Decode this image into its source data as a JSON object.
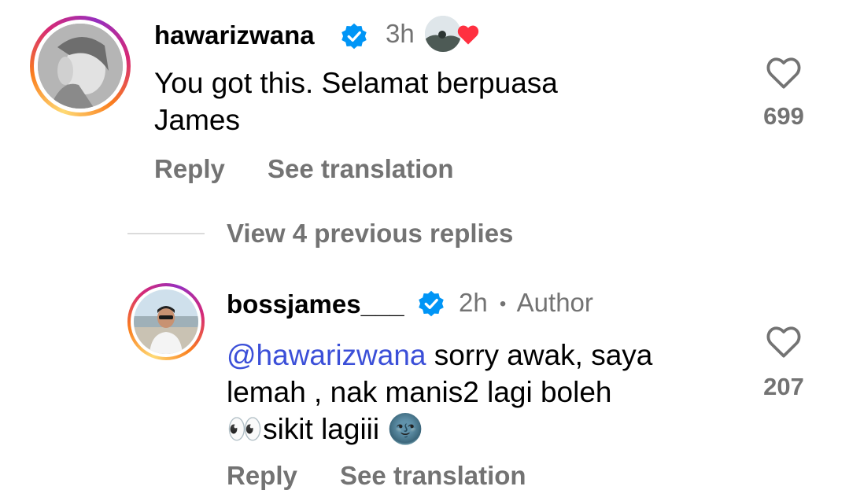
{
  "comments": [
    {
      "username": "hawarizwana",
      "time": "3h",
      "text_lines": [
        "You got this. Selamat berpuasa",
        "James"
      ],
      "like_count": "699",
      "reply_label": "Reply",
      "translate_label": "See translation"
    }
  ],
  "view_replies_label": "View 4 previous replies",
  "reply": {
    "username": "bossjames___",
    "time": "2h",
    "separator": "•",
    "author_label": "Author",
    "mention": "@hawarizwana",
    "text_line1_rest": " sorry awak, saya",
    "text_line2": "lemah , nak manis2 lagi boleh",
    "text_line3_emoji": "👀",
    "text_line3": "sikit lagiii",
    "text_line3_end_emoji": "🌚",
    "like_count": "207",
    "reply_label": "Reply",
    "translate_label": "See translation"
  },
  "colors": {
    "verified": "#0095f6",
    "secondary_text": "#737373",
    "mention": "#3b4fd8",
    "liked_heart": "#ff3040"
  }
}
